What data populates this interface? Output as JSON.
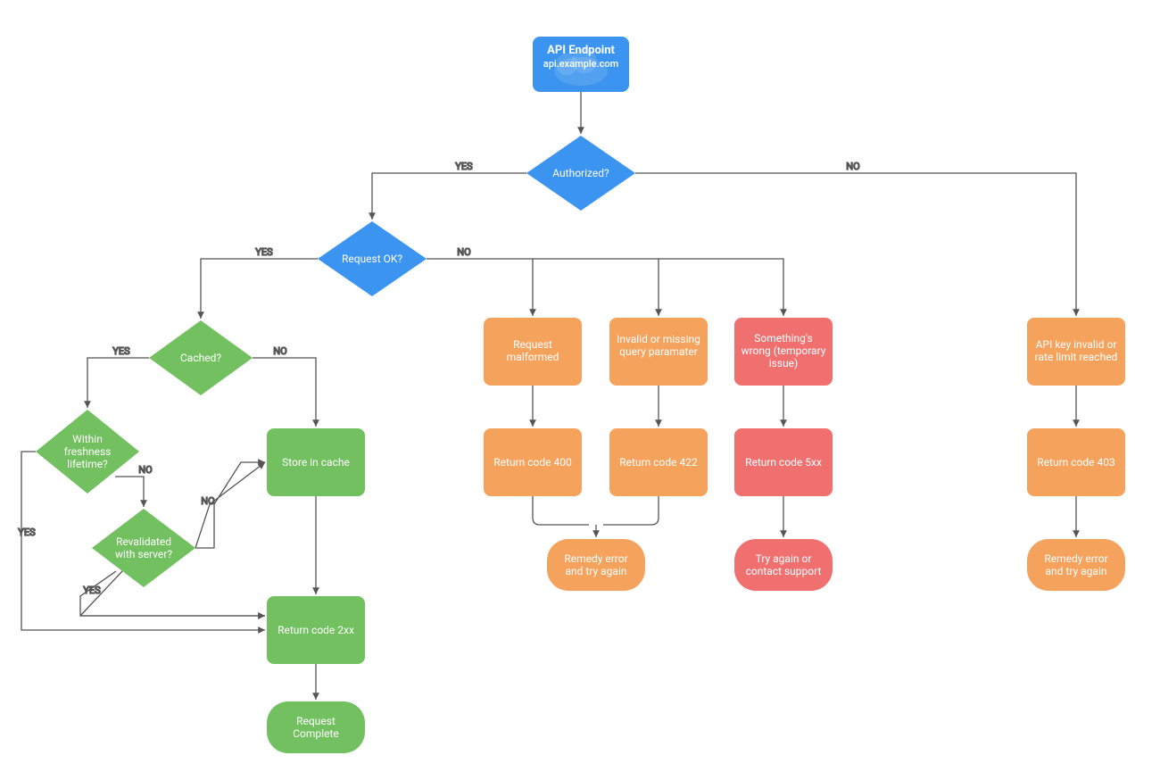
{
  "colors": {
    "blue": "#3b94f0",
    "green": "#73c061",
    "orange": "#f5a25d",
    "red": "#f07070",
    "arrow": "#555555"
  },
  "nodes": {
    "start": {
      "title": "API Endpoint",
      "subtitle": "api.example.com"
    },
    "authorized": "Authorized?",
    "requestOk": "Request OK?",
    "cached": "Cached?",
    "freshness": "Within freshness lifetime?",
    "revalidated": "Revalidated with server?",
    "storeCache": "Store in cache",
    "return2xx": "Return code 2xx",
    "requestComplete": "Request Complete",
    "reqMalformed": "Request malformed",
    "invalidQuery": "Invalid or missing query paramater",
    "somethingWrong": "Something's wrong (temporary issue)",
    "return400": "Return code 400",
    "return422": "Return code 422",
    "return5xx": "Return code 5xx",
    "remedyError1": "Remedy error and try again",
    "tryAgain": "Try again or contact support",
    "apiKeyInvalid": "API key invalid or rate limit reached",
    "return403": "Return code 403",
    "remedyError2": "Remedy error and try again"
  },
  "edges": {
    "yes": "YES",
    "no": "NO"
  }
}
